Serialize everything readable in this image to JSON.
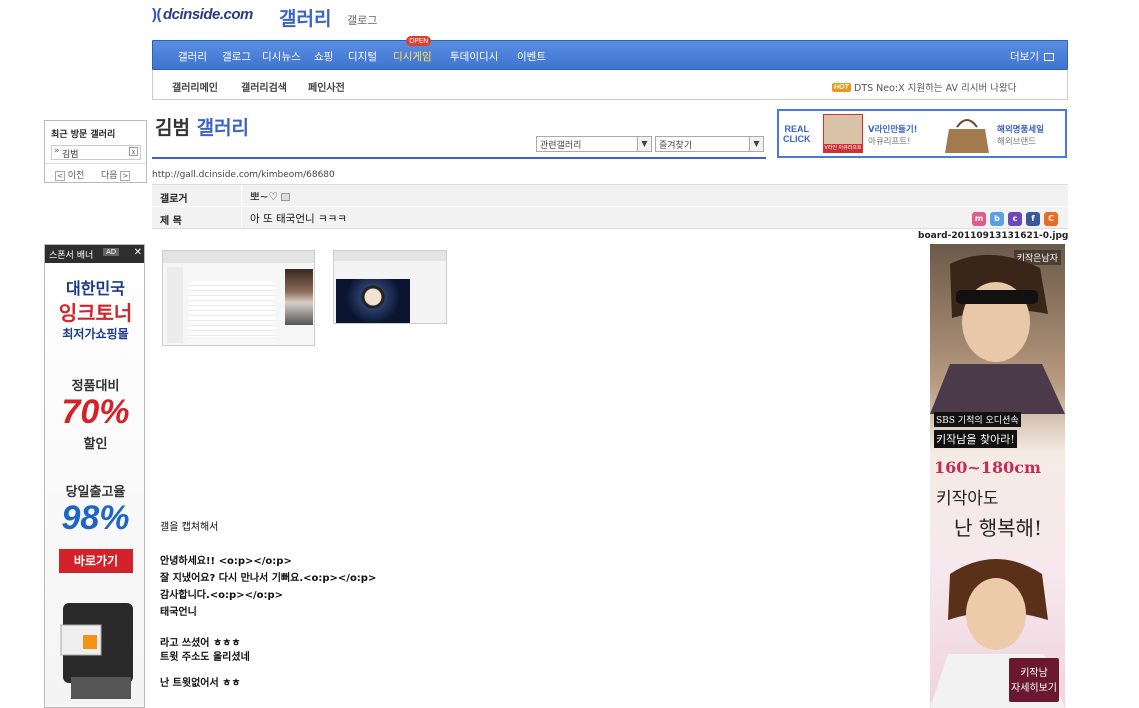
{
  "header": {
    "logo": "dcinside.com",
    "gallery_title": "갤러리",
    "gallog": "갤로그"
  },
  "nav": {
    "items": [
      "갤러리",
      "갤로그",
      "디시뉴스",
      "쇼핑",
      "디지털",
      "디시게임",
      "투데이디시",
      "이벤트"
    ],
    "open_badge": "OPEN",
    "more": "더보기"
  },
  "subnav": {
    "items": [
      "갤러리메인",
      "갤러리검색",
      "페인사전"
    ],
    "hot_badge": "HOT",
    "hot_text": "DTS Neo:X 지원하는 AV 리시버 나왔다"
  },
  "recent": {
    "title": "최근 방문 갤러리",
    "item": "김범",
    "prev": "이전",
    "next": "다음"
  },
  "sponsor": {
    "label": "스폰서 배너",
    "ad_tag": "AD",
    "close": "✕",
    "lines": [
      "대한민국",
      "잉크토너",
      "최저가쇼핑몰",
      "정품대비",
      "70%",
      "할인",
      "당일출고율",
      "98%",
      "바로가기"
    ]
  },
  "board": {
    "name": "김범",
    "suffix": "갤러리",
    "select1": "관련갤러리",
    "select2": "즐겨찾기",
    "url": "http://gall.dcinside.com/kimbeom/68680",
    "author_label": "갤로거",
    "author": "뽀~♡",
    "title_label": "제 목",
    "title": "아 또 태국언니 ㅋㅋㅋ",
    "filename": "board-20110913131621-0.jpg"
  },
  "ad_top": {
    "real": "REAL",
    "click": "CLICK",
    "item1_title": "V라인만들기!",
    "item1_sub": "아큐리프트!",
    "item1_img_caption": "V라인 아큐리프트",
    "item2_title": "해외명품세일",
    "item2_sub": "해외브랜드"
  },
  "post": {
    "lines": [
      "갤을 캡쳐해서",
      "안녕하세요!!  <o:p></o:p>",
      "잘 지냈어요?  다시 만나서 기뻐요.<o:p></o:p>",
      " 감사합니다.<o:p></o:p>",
      " 태국언니",
      "라고 쓰셨어 ㅎㅎㅎ",
      "트윗 주소도 올리셨네",
      "난 트윗없어서 ㅎㅎ"
    ]
  },
  "ad_right": {
    "brand": "키작은남자",
    "line1": "SBS 기적의 오디션속",
    "line2": "키작남을 찾아라!",
    "line3": "160~180cm",
    "line4": "키작아도",
    "line5": "난 행복해!",
    "btn1": "키작남",
    "btn2": "자세히보기"
  },
  "colors": {
    "accent": "#3b63c4",
    "nav": "#4a80dc"
  }
}
